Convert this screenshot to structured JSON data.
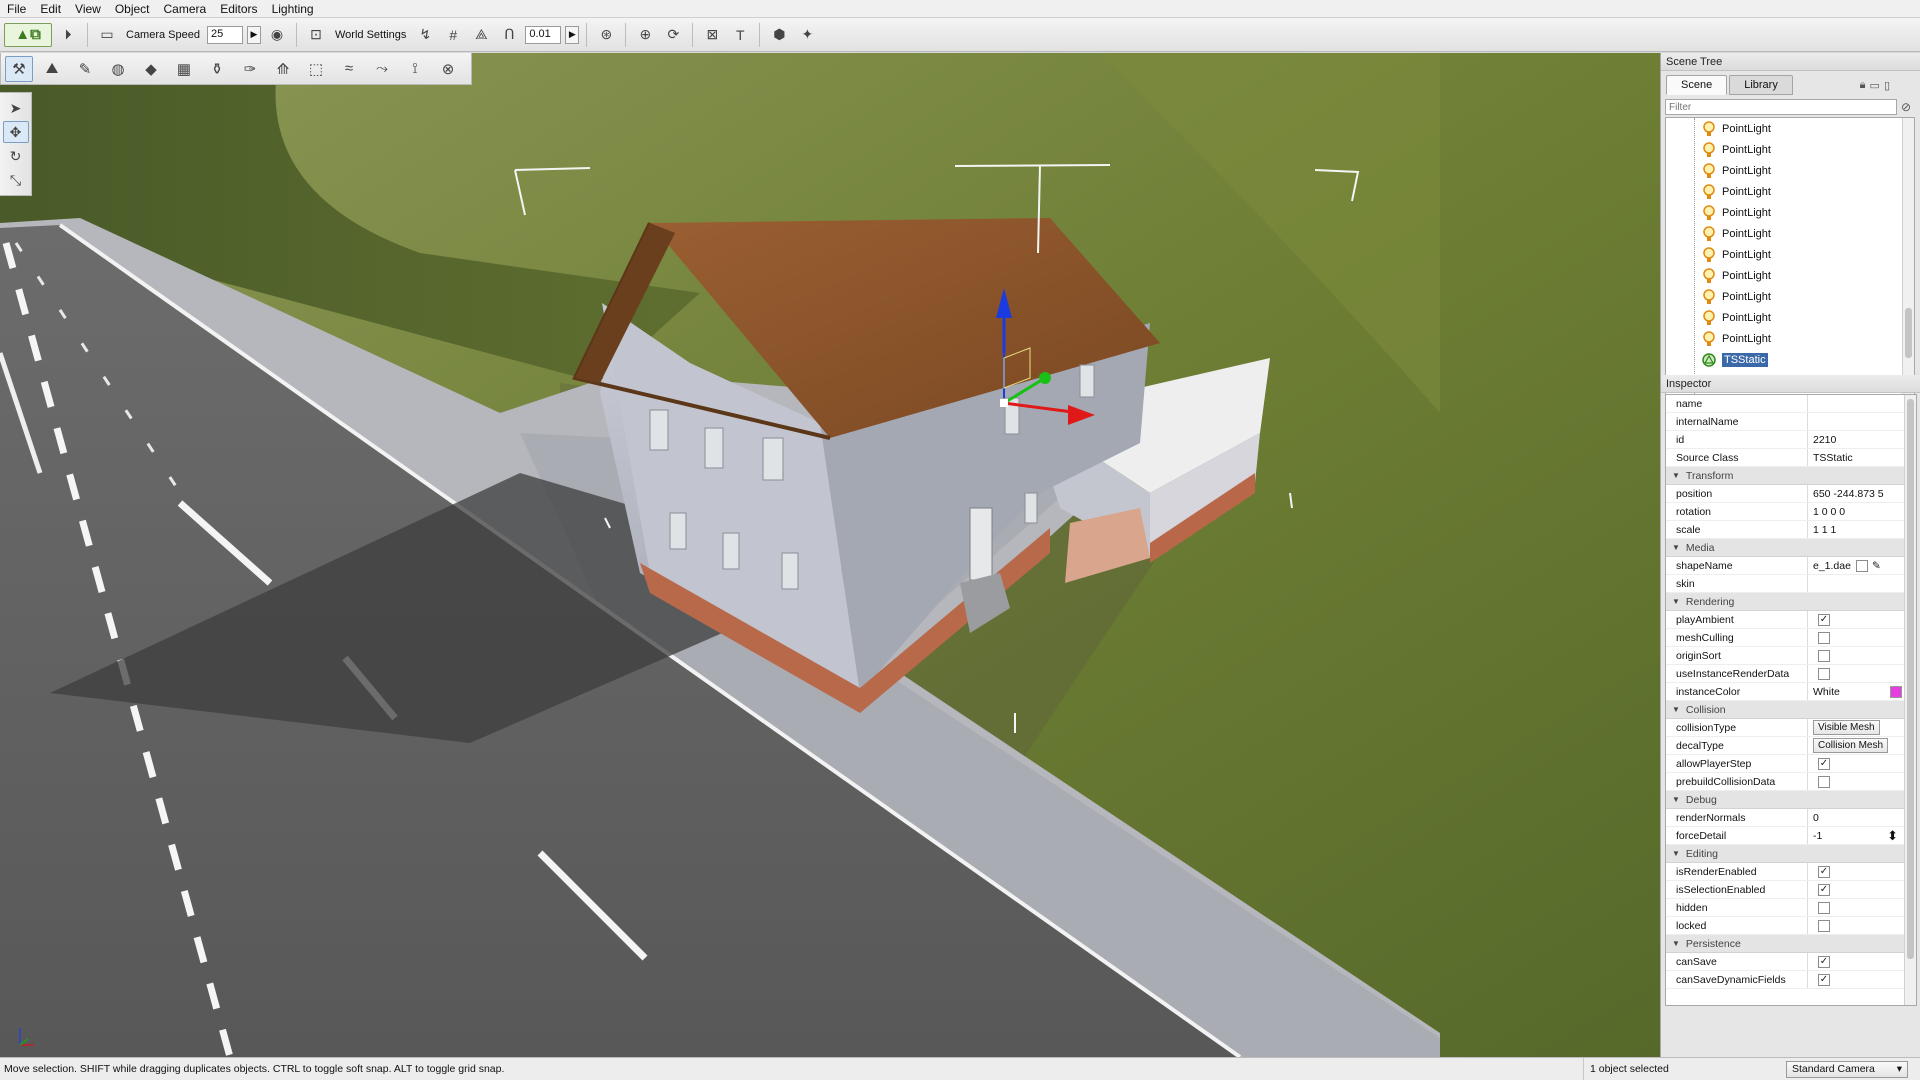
{
  "menu": [
    "File",
    "Edit",
    "View",
    "Object",
    "Camera",
    "Editors",
    "Lighting"
  ],
  "toolbar": {
    "camera_speed_label": "Camera Speed",
    "camera_speed_value": "25",
    "world_settings_label": "World Settings",
    "snap_value": "0.01"
  },
  "scene_tree": {
    "title": "Scene Tree",
    "tabs": [
      "Scene",
      "Library"
    ],
    "filter_placeholder": "Filter",
    "items": [
      {
        "label": "PointLight",
        "type": "light"
      },
      {
        "label": "PointLight",
        "type": "light"
      },
      {
        "label": "PointLight",
        "type": "light"
      },
      {
        "label": "PointLight",
        "type": "light"
      },
      {
        "label": "PointLight",
        "type": "light"
      },
      {
        "label": "PointLight",
        "type": "light"
      },
      {
        "label": "PointLight",
        "type": "light"
      },
      {
        "label": "PointLight",
        "type": "light"
      },
      {
        "label": "PointLight",
        "type": "light"
      },
      {
        "label": "PointLight",
        "type": "light"
      },
      {
        "label": "PointLight",
        "type": "light"
      },
      {
        "label": "TSStatic",
        "type": "static",
        "selected": true
      }
    ]
  },
  "inspector": {
    "title": "Inspector",
    "rows": [
      {
        "key": "name",
        "value": ""
      },
      {
        "key": "internalName",
        "value": ""
      },
      {
        "key": "id",
        "value": "2210"
      },
      {
        "key": "Source Class",
        "value": "TSStatic"
      }
    ],
    "sections": [
      {
        "title": "Transform",
        "rows": [
          {
            "key": "position",
            "value": "650 -244.873 5"
          },
          {
            "key": "rotation",
            "value": "1 0 0 0"
          },
          {
            "key": "scale",
            "value": "1 1 1"
          }
        ]
      },
      {
        "title": "Media",
        "rows": [
          {
            "key": "shapeName",
            "value": "e_1.dae",
            "kind": "file"
          },
          {
            "key": "skin",
            "value": ""
          }
        ]
      },
      {
        "title": "Rendering",
        "rows": [
          {
            "key": "playAmbient",
            "checked": true,
            "kind": "check"
          },
          {
            "key": "meshCulling",
            "checked": false,
            "kind": "check"
          },
          {
            "key": "originSort",
            "checked": false,
            "kind": "check"
          },
          {
            "key": "useInstanceRenderData",
            "checked": false,
            "kind": "check"
          },
          {
            "key": "instanceColor",
            "value": "White",
            "kind": "color",
            "color": "#e53de0"
          }
        ]
      },
      {
        "title": "Collision",
        "rows": [
          {
            "key": "collisionType",
            "value": "Visible Mesh",
            "kind": "dropdown"
          },
          {
            "key": "decalType",
            "value": "Collision Mesh",
            "kind": "dropdown"
          },
          {
            "key": "allowPlayerStep",
            "checked": true,
            "kind": "check"
          },
          {
            "key": "prebuildCollisionData",
            "checked": false,
            "kind": "check"
          }
        ]
      },
      {
        "title": "Debug",
        "rows": [
          {
            "key": "renderNormals",
            "value": "0"
          },
          {
            "key": "forceDetail",
            "value": "-1",
            "kind": "spinner"
          }
        ]
      },
      {
        "title": "Editing",
        "rows": [
          {
            "key": "isRenderEnabled",
            "checked": true,
            "kind": "check"
          },
          {
            "key": "isSelectionEnabled",
            "checked": true,
            "kind": "check"
          },
          {
            "key": "hidden",
            "checked": false,
            "kind": "check"
          },
          {
            "key": "locked",
            "checked": false,
            "kind": "check"
          }
        ]
      },
      {
        "title": "Persistence",
        "rows": [
          {
            "key": "canSave",
            "checked": true,
            "kind": "check"
          },
          {
            "key": "canSaveDynamicFields",
            "checked": true,
            "kind": "check"
          }
        ]
      }
    ]
  },
  "status": {
    "message": "Move selection.  SHIFT while dragging duplicates objects.  CTRL to toggle soft snap.  ALT to toggle grid snap.",
    "selection": "1 object selected",
    "camera": "Standard Camera"
  },
  "colors": {
    "selection": "#3b69a8",
    "gizmo_x": "#e01818",
    "gizmo_y": "#18c018",
    "gizmo_z": "#1a3be0"
  }
}
